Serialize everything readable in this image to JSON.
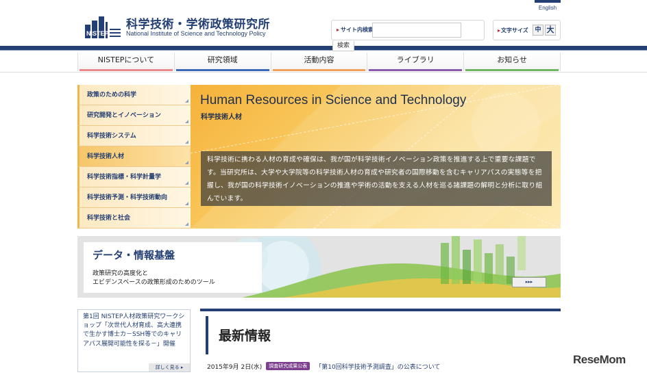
{
  "header": {
    "english_link": "English",
    "logo_mark_text": "NISTEP",
    "logo_jp": "科学技術・学術政策研究所",
    "logo_en": "National Institute of Science and Technology Policy",
    "search_label": "サイト内検索",
    "search_value": "",
    "search_button": "検索",
    "fontsize_label": "文字サイズ",
    "fontsize_mid": "中",
    "fontsize_large": "大"
  },
  "gnav": [
    {
      "label": "NISTEPについて",
      "color": "#e98a8f"
    },
    {
      "label": "研究領域",
      "color": "#3a67b6"
    },
    {
      "label": "活動内容",
      "color": "#f0a25a"
    },
    {
      "label": "ライブラリ",
      "color": "#8a5bab"
    },
    {
      "label": "お知らせ",
      "color": "#6fb562"
    }
  ],
  "sidemenu": [
    "政策のための科学",
    "研究開発とイノベーション",
    "科学技術システム",
    "科学技術人材",
    "科学技術指標・科学計量学",
    "科学技術予測・科学技術動向",
    "科学技術と社会"
  ],
  "hero": {
    "title": "Human Resources in Science and Technology",
    "subtitle": "科学技術人材",
    "text": "科学技術に携わる人材の育成や確保は、我が国が科学技術イノベーション政策を推進する上で重要な課題です。当研究所は、大学や大学院等の科学技術人材の育成や研究者の国際移動を含むキャリアパスの実態等を把握し、我が国の科学技術イノベーションの推進や学術の活動を支える人材を巡る諸課題の解明と分析に取り組んでいます。"
  },
  "data_banner": {
    "title": "データ・情報基盤",
    "desc_line1": "政策研究の高度化と",
    "desc_line2": "エビデンスベースの政策形成のためのツール",
    "button": "▸▸▸"
  },
  "side_news": {
    "text": "第1回 NISTEP人材政策研究ワークショップ「次世代人材育成、高大連携で生かす博士カ－SSH等でのキャリアパス展開可能性を探る－」開催",
    "more": "詳しく見る ▸"
  },
  "latest": {
    "title": "最新情報",
    "items": [
      {
        "date": "2015年9月 2日(水)",
        "badge": "調査研究成果公表",
        "link": "「第10回科学技術予測調査」の公表について"
      }
    ]
  },
  "watermark": "ReseMom"
}
